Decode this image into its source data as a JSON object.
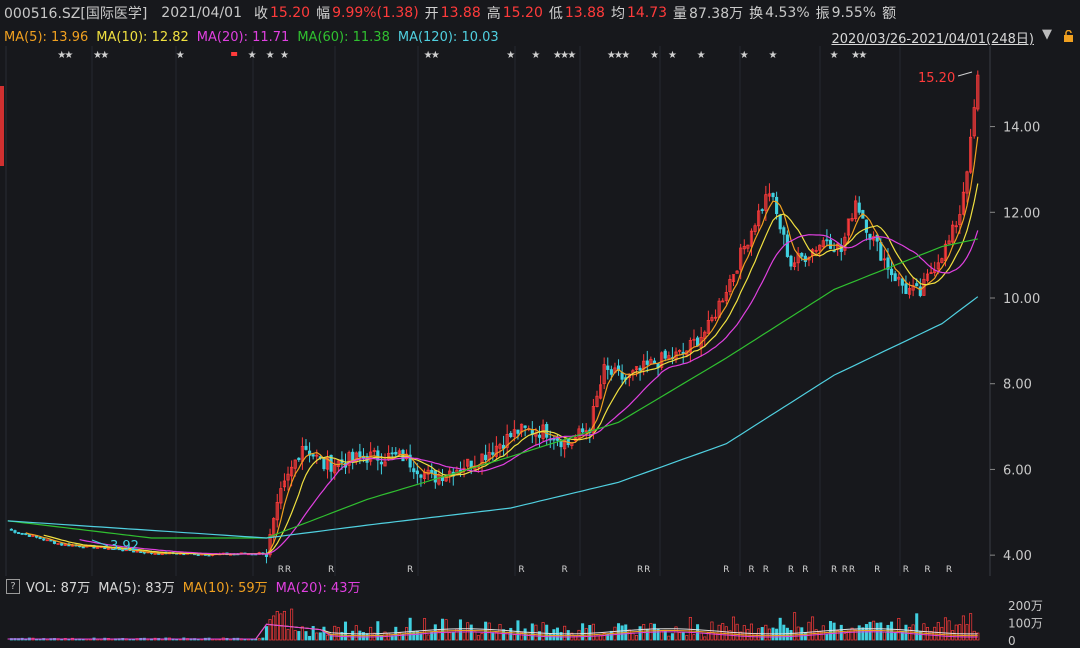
{
  "header": {
    "code": "000516.SZ[国际医学]",
    "date": "2021/04/01",
    "close_label": "收",
    "close": "15.20",
    "change_label": "幅",
    "change": "9.99%(1.38)",
    "open_label": "开",
    "open": "13.88",
    "high_label": "高",
    "high": "15.20",
    "low_label": "低",
    "low": "13.88",
    "avg_label": "均",
    "avg": "14.73",
    "vol_label": "量",
    "vol": "87.38万",
    "turnover_label": "换",
    "turnover": "4.53%",
    "amp_label": "振",
    "amp": "9.55%",
    "amount_label": "额"
  },
  "ma_legend": [
    {
      "text": "MA(5): 13.96",
      "color": "#f0a020"
    },
    {
      "text": "MA(10): 12.82",
      "color": "#f0e040"
    },
    {
      "text": "MA(20): 11.71",
      "color": "#e040e0"
    },
    {
      "text": "MA(60): 11.38",
      "color": "#30c030"
    },
    {
      "text": "MA(120): 10.03",
      "color": "#50d0e0"
    }
  ],
  "range_text": "2020/03/26-2021/04/01(248日)",
  "range_arrow": "▼",
  "vol_legend": {
    "q": "?",
    "vol": "VOL: 87万",
    "ma5": "MA(5): 83万",
    "ma10": "MA(10): 59万",
    "ma20": "MA(20): 43万"
  },
  "annotations": {
    "max_label": "15.20",
    "min_label": "3.92"
  },
  "colors": {
    "up": "#ff3b3b",
    "down": "#40d0e0",
    "grid": "#2c2e35",
    "axis_text": "#c8c8c8"
  },
  "chart_data": {
    "type": "candlestick",
    "days": 248,
    "ylim": [
      3.7,
      15.6
    ],
    "price_ticks": [
      "4.00",
      "6.00",
      "8.00",
      "10.00",
      "12.00",
      "14.00"
    ],
    "volume_ticks": [
      "200万",
      "100万",
      "0"
    ],
    "volume_ylim": [
      0,
      230
    ],
    "anchors": [
      [
        0,
        4.6
      ],
      [
        15,
        4.25
      ],
      [
        30,
        4.15
      ],
      [
        40,
        4.05
      ],
      [
        60,
        4.02
      ],
      [
        72,
        4.05
      ],
      [
        76,
        5.4
      ],
      [
        82,
        6.6
      ],
      [
        88,
        6.1
      ],
      [
        100,
        6.3
      ],
      [
        110,
        6.3
      ],
      [
        118,
        5.8
      ],
      [
        130,
        6.2
      ],
      [
        142,
        6.9
      ],
      [
        150,
        6.9
      ],
      [
        156,
        6.6
      ],
      [
        162,
        7.0
      ],
      [
        166,
        8.3
      ],
      [
        172,
        8.1
      ],
      [
        180,
        8.5
      ],
      [
        188,
        8.7
      ],
      [
        195,
        9.3
      ],
      [
        203,
        10.8
      ],
      [
        208,
        11.8
      ],
      [
        212,
        12.5
      ],
      [
        218,
        10.8
      ],
      [
        222,
        11.0
      ],
      [
        228,
        11.4
      ],
      [
        232,
        11.1
      ],
      [
        236,
        12.3
      ],
      [
        240,
        11.5
      ],
      [
        246,
        10.6
      ],
      [
        250,
        10.2
      ],
      [
        254,
        10.1
      ],
      [
        258,
        10.8
      ],
      [
        262,
        11.3
      ],
      [
        265,
        12.0
      ],
      [
        268,
        13.6
      ],
      [
        270,
        15.2
      ]
    ],
    "ma120_anchors": [
      [
        0,
        4.8
      ],
      [
        72,
        4.4
      ],
      [
        100,
        4.7
      ],
      [
        140,
        5.1
      ],
      [
        170,
        5.7
      ],
      [
        200,
        6.6
      ],
      [
        230,
        8.2
      ],
      [
        260,
        9.4
      ],
      [
        270,
        10.03
      ]
    ],
    "ma60_anchors": [
      [
        0,
        4.8
      ],
      [
        40,
        4.4
      ],
      [
        72,
        4.4
      ],
      [
        100,
        5.3
      ],
      [
        140,
        6.3
      ],
      [
        170,
        7.1
      ],
      [
        200,
        8.6
      ],
      [
        230,
        10.2
      ],
      [
        260,
        11.2
      ],
      [
        270,
        11.38
      ]
    ],
    "star_positions": [
      15,
      17,
      25,
      27,
      48,
      68,
      73,
      77,
      117,
      119,
      140,
      147,
      153,
      155,
      157,
      168,
      170,
      172,
      180,
      185,
      193,
      205,
      213,
      230,
      236,
      238
    ],
    "r_positions": [
      76,
      78,
      90,
      112,
      143,
      155,
      176,
      178,
      200,
      207,
      211,
      218,
      222,
      230,
      233,
      235,
      242,
      250,
      256,
      262
    ],
    "red_marker": 63
  }
}
